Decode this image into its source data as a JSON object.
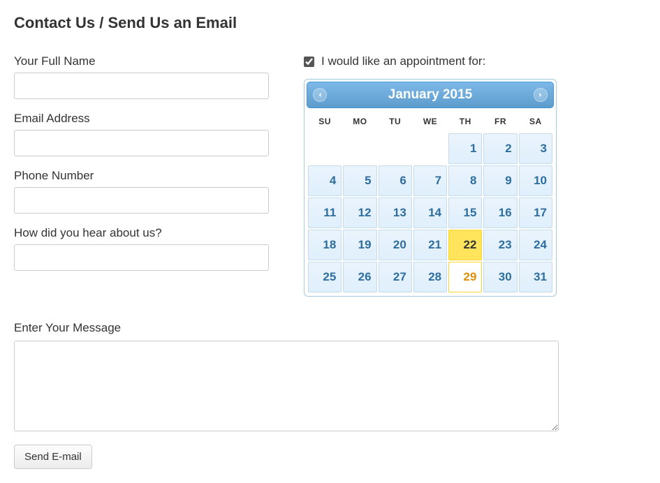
{
  "title": "Contact Us / Send Us an Email",
  "form": {
    "fullNameLabel": "Your Full Name",
    "fullNameValue": "",
    "emailLabel": "Email Address",
    "emailValue": "",
    "phoneLabel": "Phone Number",
    "phoneValue": "",
    "hearLabel": "How did you hear about us?",
    "hearValue": "",
    "messageLabel": "Enter Your Message",
    "messageValue": "",
    "submitLabel": "Send E-mail"
  },
  "appointment": {
    "checkboxLabel": "I would like an appointment for:",
    "checked": true
  },
  "calendar": {
    "title": "January 2015",
    "dayHeaders": [
      "SU",
      "MO",
      "TU",
      "WE",
      "TH",
      "FR",
      "SA"
    ],
    "weeks": [
      [
        {
          "day": null
        },
        {
          "day": null
        },
        {
          "day": null
        },
        {
          "day": null
        },
        {
          "day": 1
        },
        {
          "day": 2
        },
        {
          "day": 3
        }
      ],
      [
        {
          "day": 4
        },
        {
          "day": 5
        },
        {
          "day": 6
        },
        {
          "day": 7
        },
        {
          "day": 8
        },
        {
          "day": 9
        },
        {
          "day": 10
        }
      ],
      [
        {
          "day": 11
        },
        {
          "day": 12
        },
        {
          "day": 13
        },
        {
          "day": 14
        },
        {
          "day": 15
        },
        {
          "day": 16
        },
        {
          "day": 17
        }
      ],
      [
        {
          "day": 18
        },
        {
          "day": 19
        },
        {
          "day": 20
        },
        {
          "day": 21
        },
        {
          "day": 22,
          "highlighted": true
        },
        {
          "day": 23
        },
        {
          "day": 24
        }
      ],
      [
        {
          "day": 25
        },
        {
          "day": 26
        },
        {
          "day": 27
        },
        {
          "day": 28
        },
        {
          "day": 29,
          "selected": true
        },
        {
          "day": 30
        },
        {
          "day": 31
        }
      ]
    ]
  }
}
